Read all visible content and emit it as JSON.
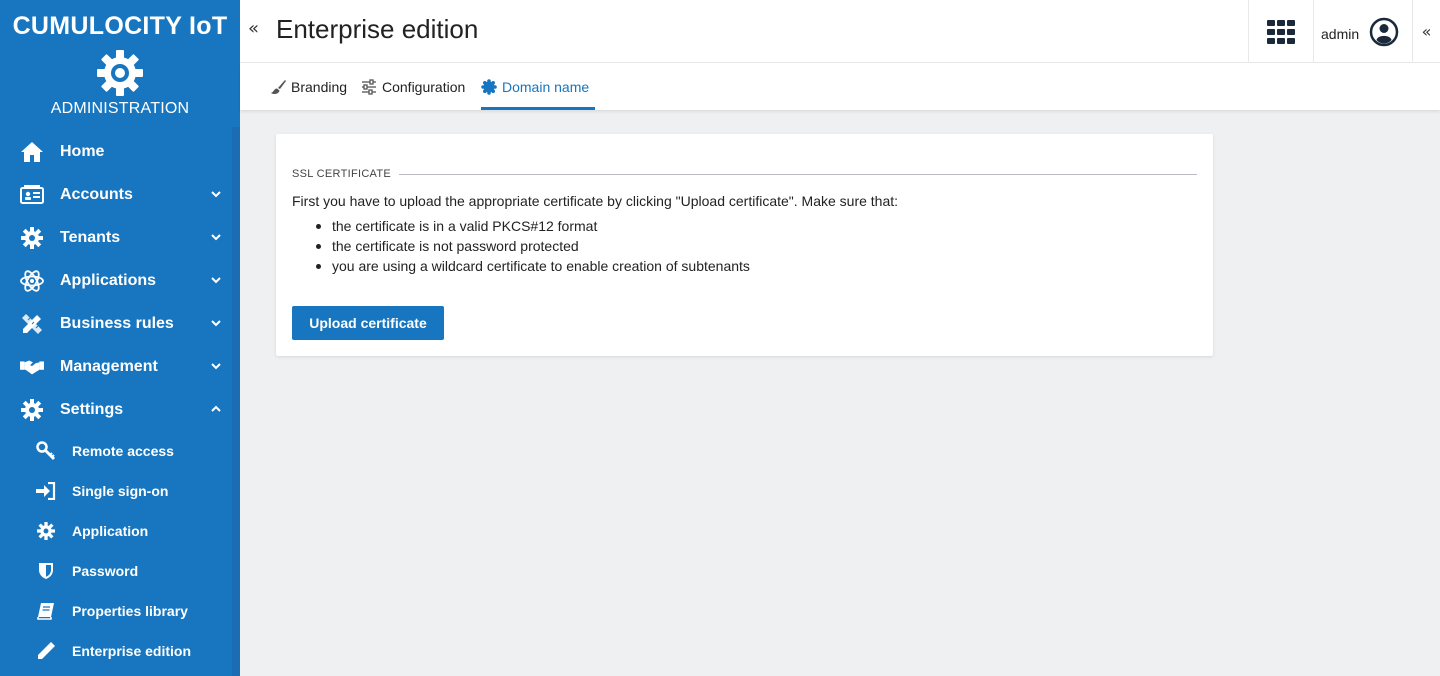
{
  "app": {
    "brand": "CUMULOCITY IoT",
    "module": "ADMINISTRATION"
  },
  "sidebar": {
    "items": [
      {
        "label": "Home",
        "icon": "home-icon"
      },
      {
        "label": "Accounts",
        "icon": "accounts-icon"
      },
      {
        "label": "Tenants",
        "icon": "tenants-gear-icon"
      },
      {
        "label": "Applications",
        "icon": "atom-icon"
      },
      {
        "label": "Business rules",
        "icon": "pencil-ruler-icon"
      },
      {
        "label": "Management",
        "icon": "handshake-icon"
      },
      {
        "label": "Settings",
        "icon": "gear-icon"
      }
    ],
    "settings_children": [
      {
        "label": "Remote access",
        "icon": "key-icon"
      },
      {
        "label": "Single sign-on",
        "icon": "sign-in-icon"
      },
      {
        "label": "Application",
        "icon": "gear-icon"
      },
      {
        "label": "Password",
        "icon": "shield-icon"
      },
      {
        "label": "Properties library",
        "icon": "book-icon"
      },
      {
        "label": "Enterprise edition",
        "icon": "pencil-icon"
      }
    ]
  },
  "header": {
    "collapse_left": "«",
    "title": "Enterprise edition",
    "user": "admin",
    "collapse_right": "«"
  },
  "tabs": [
    {
      "label": "Branding",
      "icon": "brush-icon",
      "active": false
    },
    {
      "label": "Configuration",
      "icon": "sliders-icon",
      "active": false
    },
    {
      "label": "Domain name",
      "icon": "certificate-icon",
      "active": true
    }
  ],
  "ssl": {
    "legend": "SSL CERTIFICATE",
    "intro": "First you have to upload the appropriate certificate by clicking \"Upload certificate\". Make sure that:",
    "requirements": [
      "the certificate is in a valid PKCS#12 format",
      "the certificate is not password protected",
      "you are using a wildcard certificate to enable creation of subtenants"
    ],
    "upload_label": "Upload certificate"
  },
  "colors": {
    "primary": "#1776bf",
    "background": "#eef0f2",
    "text": "#222222"
  }
}
